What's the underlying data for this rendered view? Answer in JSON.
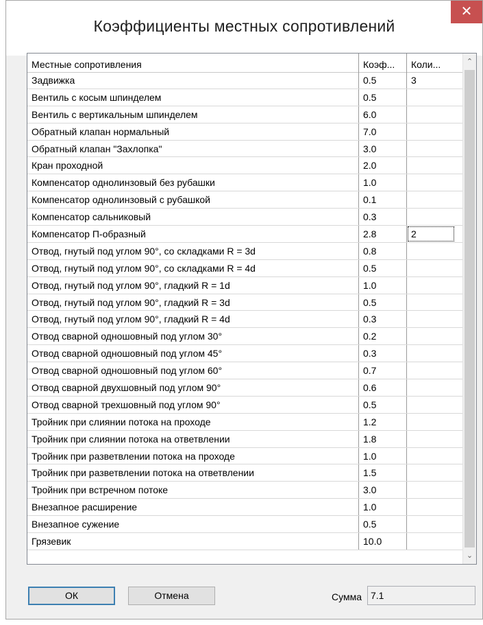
{
  "window": {
    "title": "Коэффициенты местных сопротивлений",
    "close_glyph": "✕"
  },
  "table": {
    "columns": [
      "Местные сопротивления",
      "Коэф...",
      "Коли..."
    ],
    "rows": [
      {
        "name": "Задвижка",
        "coef": "0.5",
        "qty": "3"
      },
      {
        "name": "Вентиль с косым шпинделем",
        "coef": "0.5",
        "qty": ""
      },
      {
        "name": "Вентиль с вертикальным шпинделем",
        "coef": "6.0",
        "qty": ""
      },
      {
        "name": "Обратный клапан нормальный",
        "coef": "7.0",
        "qty": ""
      },
      {
        "name": "Обратный клапан \"Захлопка\"",
        "coef": "3.0",
        "qty": ""
      },
      {
        "name": "Кран проходной",
        "coef": "2.0",
        "qty": ""
      },
      {
        "name": "Компенсатор однолинзовый без рубашки",
        "coef": "1.0",
        "qty": ""
      },
      {
        "name": "Компенсатор однолинзовый с рубашкой",
        "coef": "0.1",
        "qty": ""
      },
      {
        "name": "Компенсатор сальниковый",
        "coef": "0.3",
        "qty": ""
      },
      {
        "name": "Компенсатор П-образный",
        "coef": "2.8",
        "qty": "2"
      },
      {
        "name": "Отвод, гнутый под углом 90°, со складками R = 3d",
        "coef": "0.8",
        "qty": ""
      },
      {
        "name": "Отвод, гнутый под углом 90°, со складками R = 4d",
        "coef": "0.5",
        "qty": ""
      },
      {
        "name": "Отвод, гнутый под углом 90°, гладкий R = 1d",
        "coef": "1.0",
        "qty": ""
      },
      {
        "name": "Отвод, гнутый под углом 90°, гладкий R = 3d",
        "coef": "0.5",
        "qty": ""
      },
      {
        "name": "Отвод, гнутый под углом 90°, гладкий R = 4d",
        "coef": "0.3",
        "qty": ""
      },
      {
        "name": "Отвод сварной одношовный под углом 30°",
        "coef": "0.2",
        "qty": ""
      },
      {
        "name": "Отвод сварной одношовный под углом 45°",
        "coef": "0.3",
        "qty": ""
      },
      {
        "name": "Отвод сварной одношовный под углом 60°",
        "coef": "0.7",
        "qty": ""
      },
      {
        "name": "Отвод сварной двухшовный под углом 90°",
        "coef": "0.6",
        "qty": ""
      },
      {
        "name": "Отвод сварной трехшовный под углом 90°",
        "coef": "0.5",
        "qty": ""
      },
      {
        "name": "Тройник при слиянии потока на проходе",
        "coef": "1.2",
        "qty": ""
      },
      {
        "name": "Тройник при слиянии потока на ответвлении",
        "coef": "1.8",
        "qty": ""
      },
      {
        "name": "Тройник при разветвлении потока на проходе",
        "coef": "1.0",
        "qty": ""
      },
      {
        "name": "Тройник при разветвлении потока на ответвлении",
        "coef": "1.5",
        "qty": ""
      },
      {
        "name": "Тройник при встречном потоке",
        "coef": "3.0",
        "qty": ""
      },
      {
        "name": "Внезапное расширение",
        "coef": "1.0",
        "qty": ""
      },
      {
        "name": "Внезапное сужение",
        "coef": "0.5",
        "qty": ""
      },
      {
        "name": "Грязевик",
        "coef": "10.0",
        "qty": ""
      }
    ],
    "focused_row": 9,
    "scroll_up_glyph": "⌃",
    "scroll_down_glyph": "⌄"
  },
  "buttons": {
    "ok": "ОК",
    "cancel": "Отмена"
  },
  "sum": {
    "label": "Сумма",
    "value": "7.1"
  },
  "colors": {
    "close": "#c75050",
    "ok_border": "#3c7fb1",
    "scroll_thumb": "#cdcdcd"
  }
}
